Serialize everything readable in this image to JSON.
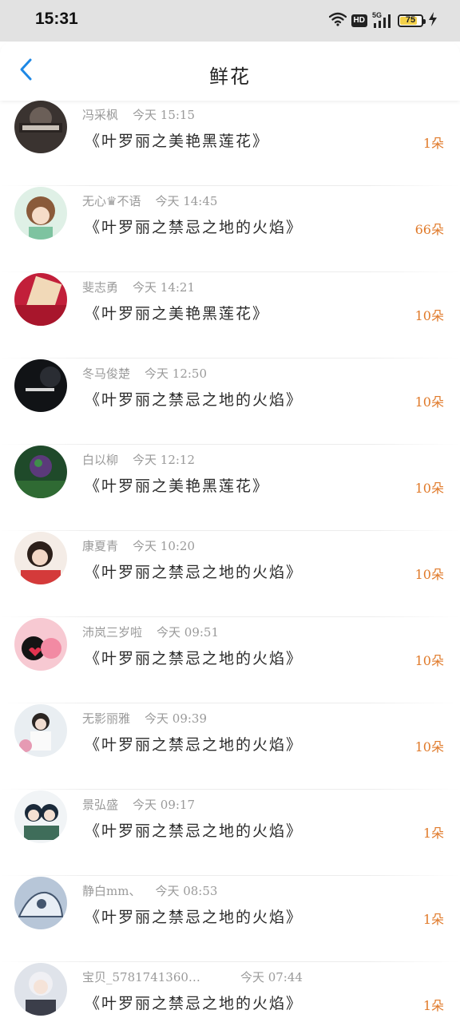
{
  "status_bar": {
    "time": "15:31",
    "hd_label": "HD",
    "network_label": "5G",
    "battery_level": "75",
    "battery_fraction": 0.75
  },
  "header": {
    "title": "鲜花",
    "back_icon": "chevron-left-icon"
  },
  "colors": {
    "accent_back": "#1e88e5",
    "count_orange": "#e07a2a",
    "meta_gray": "#9a9a9a"
  },
  "gifts": [
    {
      "name": "冯采枫",
      "time": "今天 15:15",
      "title": "《叶罗丽之美艳黑莲花》",
      "count": "1朵"
    },
    {
      "name": "无心♛不语",
      "time": "今天 14:45",
      "title": "《叶罗丽之禁忌之地的火焰》",
      "count": "66朵"
    },
    {
      "name": "斐志勇",
      "time": "今天 14:21",
      "title": "《叶罗丽之美艳黑莲花》",
      "count": "10朵"
    },
    {
      "name": "冬马俊楚",
      "time": "今天 12:50",
      "title": "《叶罗丽之禁忌之地的火焰》",
      "count": "10朵"
    },
    {
      "name": "白以柳",
      "time": "今天 12:12",
      "title": "《叶罗丽之美艳黑莲花》",
      "count": "10朵"
    },
    {
      "name": "康夏青",
      "time": "今天 10:20",
      "title": "《叶罗丽之禁忌之地的火焰》",
      "count": "10朵"
    },
    {
      "name": "沛岚三岁啦",
      "time": "今天 09:51",
      "title": "《叶罗丽之禁忌之地的火焰》",
      "count": "10朵"
    },
    {
      "name": "无影丽雅",
      "time": "今天 09:39",
      "title": "《叶罗丽之禁忌之地的火焰》",
      "count": "10朵"
    },
    {
      "name": "景弘盛",
      "time": "今天 09:17",
      "title": "《叶罗丽之禁忌之地的火焰》",
      "count": "1朵"
    },
    {
      "name": "静白mm、",
      "time": "今天 08:53",
      "title": "《叶罗丽之禁忌之地的火焰》",
      "count": "1朵"
    },
    {
      "name": "宝贝_5781741360…",
      "time": "今天 07:44",
      "title": "《叶罗丽之禁忌之地的火焰》",
      "count": "1朵"
    }
  ]
}
